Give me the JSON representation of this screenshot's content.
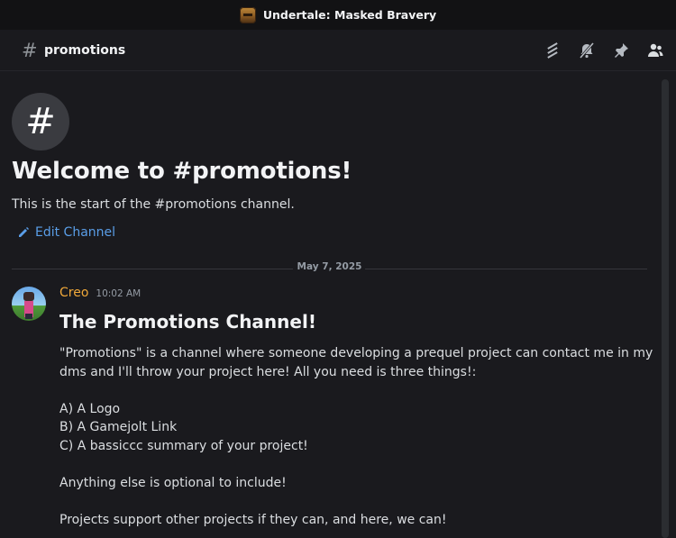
{
  "window": {
    "title": "Undertale: Masked Bravery",
    "server_icon": "server-icon"
  },
  "header": {
    "channel_hash": "#",
    "channel_name": "promotions",
    "icons": [
      "threads-icon",
      "notification-bell-muted-icon",
      "pin-icon",
      "member-list-icon"
    ]
  },
  "welcome": {
    "hash": "#",
    "title": "Welcome to #promotions!",
    "subtitle": "This is the start of the #promotions channel.",
    "edit_label": "Edit Channel"
  },
  "divider": {
    "date": "May 7, 2025"
  },
  "message": {
    "author": "Creo",
    "time": "10:02 AM",
    "author_color": "#f0a83a",
    "heading": "The Promotions Channel!",
    "line1": "\"Promotions\" is a channel where someone developing a prequel project can contact me in my dms and I'll throw your project here! All you need is three things!:",
    "list_a": "A) A Logo",
    "list_b": "B) A Gamejolt Link",
    "list_c": "C) A bassiccc summary of your project!",
    "line2": "Anything else is optional to include!",
    "line3": "Projects support other projects if they can, and here, we can!"
  },
  "colors": {
    "background": "#1a1a1e",
    "titlebar": "#121214",
    "link": "#5a9ee8"
  }
}
